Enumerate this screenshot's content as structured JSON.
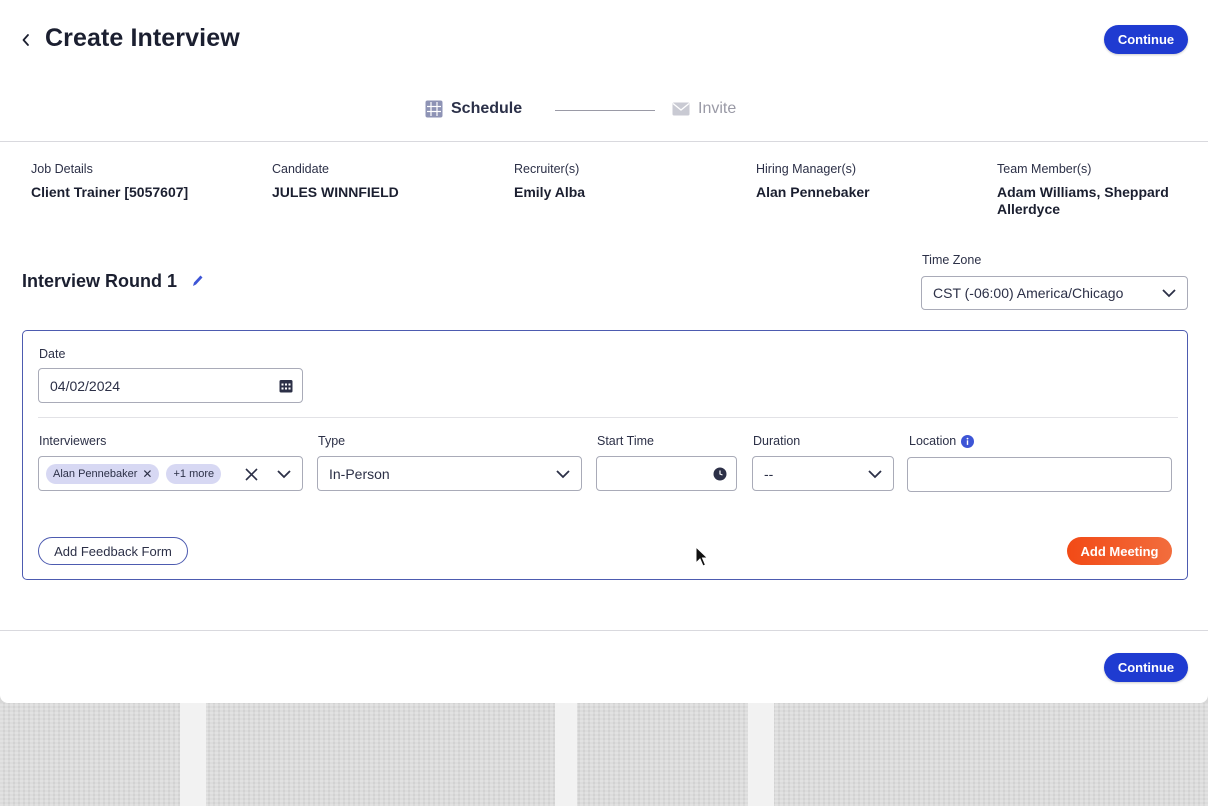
{
  "header": {
    "title": "Create Interview",
    "continue_label": "Continue"
  },
  "stepper": {
    "steps": [
      {
        "label": "Schedule",
        "active": true
      },
      {
        "label": "Invite",
        "active": false
      }
    ]
  },
  "details": [
    {
      "label": "Job Details",
      "value": "Client Trainer [5057607]"
    },
    {
      "label": "Candidate",
      "value": "JULES WINNFIELD"
    },
    {
      "label": "Recruiter(s)",
      "value": "Emily Alba"
    },
    {
      "label": "Hiring Manager(s)",
      "value": "Alan Pennebaker"
    },
    {
      "label": "Team Member(s)",
      "value": "Adam Williams, Sheppard Allerdyce"
    }
  ],
  "round": {
    "title": "Interview Round 1"
  },
  "timezone": {
    "label": "Time Zone",
    "value": "CST (-06:00) America/Chicago"
  },
  "form": {
    "date_label": "Date",
    "date_value": "04/02/2024",
    "interviewers_label": "Interviewers",
    "interviewer_chip": "Alan Pennebaker",
    "more_chip": "+1 more",
    "type_label": "Type",
    "type_value": "In-Person",
    "start_time_label": "Start Time",
    "start_time_value": "",
    "duration_label": "Duration",
    "duration_value": "--",
    "location_label": "Location",
    "location_value": "",
    "add_feedback_label": "Add Feedback Form",
    "add_meeting_label": "Add Meeting"
  },
  "footer": {
    "continue_label": "Continue"
  },
  "colors": {
    "primary": "#1f3bd1",
    "accent_orange": "#f24a16",
    "card_border": "#4d5bb0",
    "chip_bg": "#d7d8f3"
  }
}
